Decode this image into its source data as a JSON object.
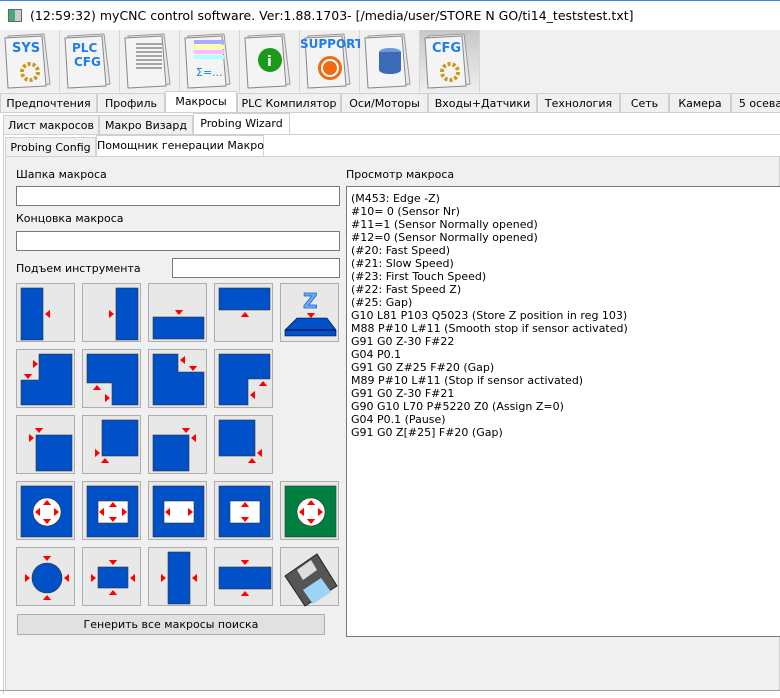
{
  "window": {
    "title": "(12:59:32)   myCNC control software. Ver:1.88.1703-   [/media/user/STORE N GO/ti14_teststest.txt]"
  },
  "toolbar": [
    {
      "icon": "sys-icon",
      "label": "SYS"
    },
    {
      "icon": "plc-cfg-icon",
      "label": "PLC CFG"
    },
    {
      "icon": "document-icon"
    },
    {
      "icon": "formula-table-icon",
      "label": "Σ=..."
    },
    {
      "icon": "info-icon",
      "label": "i"
    },
    {
      "icon": "support-icon",
      "label": "SUPPORT"
    },
    {
      "icon": "database-icon"
    },
    {
      "icon": "cfg-icon",
      "label": "CFG",
      "active": true
    }
  ],
  "main_tabs": [
    "Предпочтения",
    "Профиль",
    "Макросы",
    "PLC Компилятор",
    "Оси/Моторы",
    "Входы+Датчики",
    "Технология",
    "Сеть",
    "Камера",
    "5 осева"
  ],
  "main_tab_selected": "Макросы",
  "sub_tabs": [
    "Лист макросов",
    "Макро Визард",
    "Probing Wizard"
  ],
  "sub_tab_selected": "Probing Wizard",
  "inner_tabs": [
    "Probing Config",
    "Помощник генерации Макро"
  ],
  "inner_tab_selected": "Помощник генерации Макро",
  "form": {
    "header_label": "Шапка макроса",
    "header_value": "",
    "footer_label": "Концовка макроса",
    "footer_value": "",
    "lift_label": "Подъем инструмента",
    "lift_value": ""
  },
  "probe_buttons": [
    [
      "edge-left-icon",
      "edge-right-icon",
      "edge-bottom-icon",
      "edge-top-icon",
      "z-surface-icon"
    ],
    [
      "inner-corner-top-left-icon",
      "inner-corner-bottom-right-icon",
      "inner-corner-top-right-icon",
      "inner-corner-bottom-left-icon"
    ],
    [
      "outer-corner-top-left-icon",
      "outer-corner-bottom-left-icon",
      "outer-corner-top-right-icon",
      "outer-corner-bottom-right-icon"
    ],
    [
      "pocket-circle-icon",
      "pocket-rect-xy-icon",
      "pocket-rect-x-icon",
      "pocket-rect-y-icon",
      "pocket-circle-green-icon"
    ],
    [
      "boss-circle-icon",
      "boss-rect-xy-icon",
      "boss-rect-x-icon",
      "boss-rect-y-icon",
      "save-floppy-icon"
    ]
  ],
  "colors": {
    "part": "#0050c8",
    "arrow": "#ff0000",
    "green": "#008040"
  },
  "generate_button": "Генерить все макросы поиска",
  "preview": {
    "label": "Просмотр макроса",
    "lines": [
      "(M453: Edge -Z)",
      "#10= 0 (Sensor Nr)",
      "#11=1 (Sensor Normally opened)",
      "#12=0 (Sensor Normally opened)",
      "(#20: Fast Speed)",
      "(#21: Slow Speed)",
      "(#23: First Touch Speed)",
      "(#22: Fast Speed Z)",
      "(#25: Gap)",
      "G10 L81 P103 Q5023 (Store Z position in reg 103)",
      "M88 P#10 L#11 (Smooth stop if sensor activated)",
      "G91 G0 Z-30 F#22",
      "G04 P0.1",
      "G91 G0 Z#25 F#20 (Gap)",
      "M89 P#10 L#11 (Stop if sensor activated)",
      "G91 G0 Z-30 F#21",
      "G90 G10 L70 P#5220 Z0 (Assign Z=0)",
      "G04 P0.1 (Pause)",
      "G91 G0 Z[#25] F#20 (Gap)"
    ]
  }
}
